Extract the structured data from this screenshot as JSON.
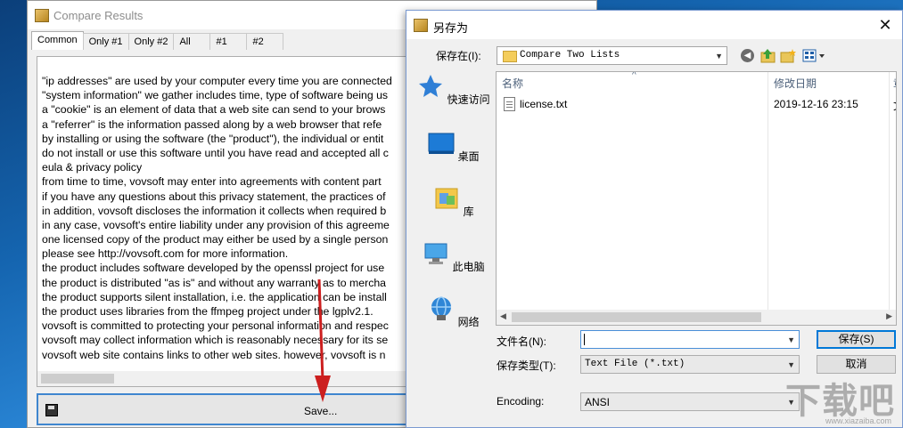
{
  "compare_window": {
    "title": "Compare Results",
    "tabs": [
      "Common",
      "Only #1",
      "Only #2",
      "All",
      "#1",
      "#2"
    ],
    "lines": [
      "\"ip addresses\" are used by your computer every time you are connected",
      "\"system information\" we gather includes time, type of software being us",
      "a \"cookie\" is an element of data that a web site can send to your brows",
      "a \"referrer\" is the information passed along by a web browser that refe",
      "by installing or using the software (the \"product\"), the individual or entit",
      "do not install or use this software until you have read and accepted all c",
      "eula & privacy policy",
      "from time to time, vovsoft may enter into agreements with content part",
      "if you have any questions about this privacy statement, the practices of",
      "in addition, vovsoft discloses the information it collects when required b",
      "in any case, vovsoft's entire liability under any provision of this agreeme",
      "one licensed copy of the product may either be used by a single person",
      "please see http://vovsoft.com for more information.",
      "the product includes software developed by the openssl project for use",
      "the product is distributed \"as is\" and without any warranty as to mercha",
      "the product supports silent installation, i.e. the application can be install",
      "the product uses libraries from the ffmpeg project under the lgplv2.1.",
      "vovsoft is committed to protecting your personal information and respec",
      "vovsoft may collect information which is reasonably necessary for its se",
      "vovsoft web site contains links to other web sites. however, vovsoft is n"
    ],
    "save_button_label": "Save..."
  },
  "save_dialog": {
    "title": "另存为",
    "close_glyph": "✕",
    "save_in_label": "保存在(I):",
    "save_in_value": "Compare Two Lists",
    "places": [
      "快速访问",
      "桌面",
      "库",
      "此电脑",
      "网络"
    ],
    "columns": [
      "名称",
      "修改日期",
      "章"
    ],
    "files": [
      {
        "name": "license.txt",
        "modified": "2019-12-16 23:15",
        "extra": "文"
      }
    ],
    "filename_label": "文件名(N):",
    "filename_value": "",
    "filetype_label": "保存类型(T):",
    "filetype_value": "Text File (*.txt)",
    "encoding_label": "Encoding:",
    "encoding_value": "ANSI",
    "save_button": "保存(S)",
    "cancel_button": "取消"
  },
  "watermark": {
    "text": "下载吧",
    "sub": "www.xiazaiba.com"
  },
  "colors": {
    "accent": "#0078d7",
    "arrow": "#cc1f1f",
    "desktop": "#1565b0"
  }
}
